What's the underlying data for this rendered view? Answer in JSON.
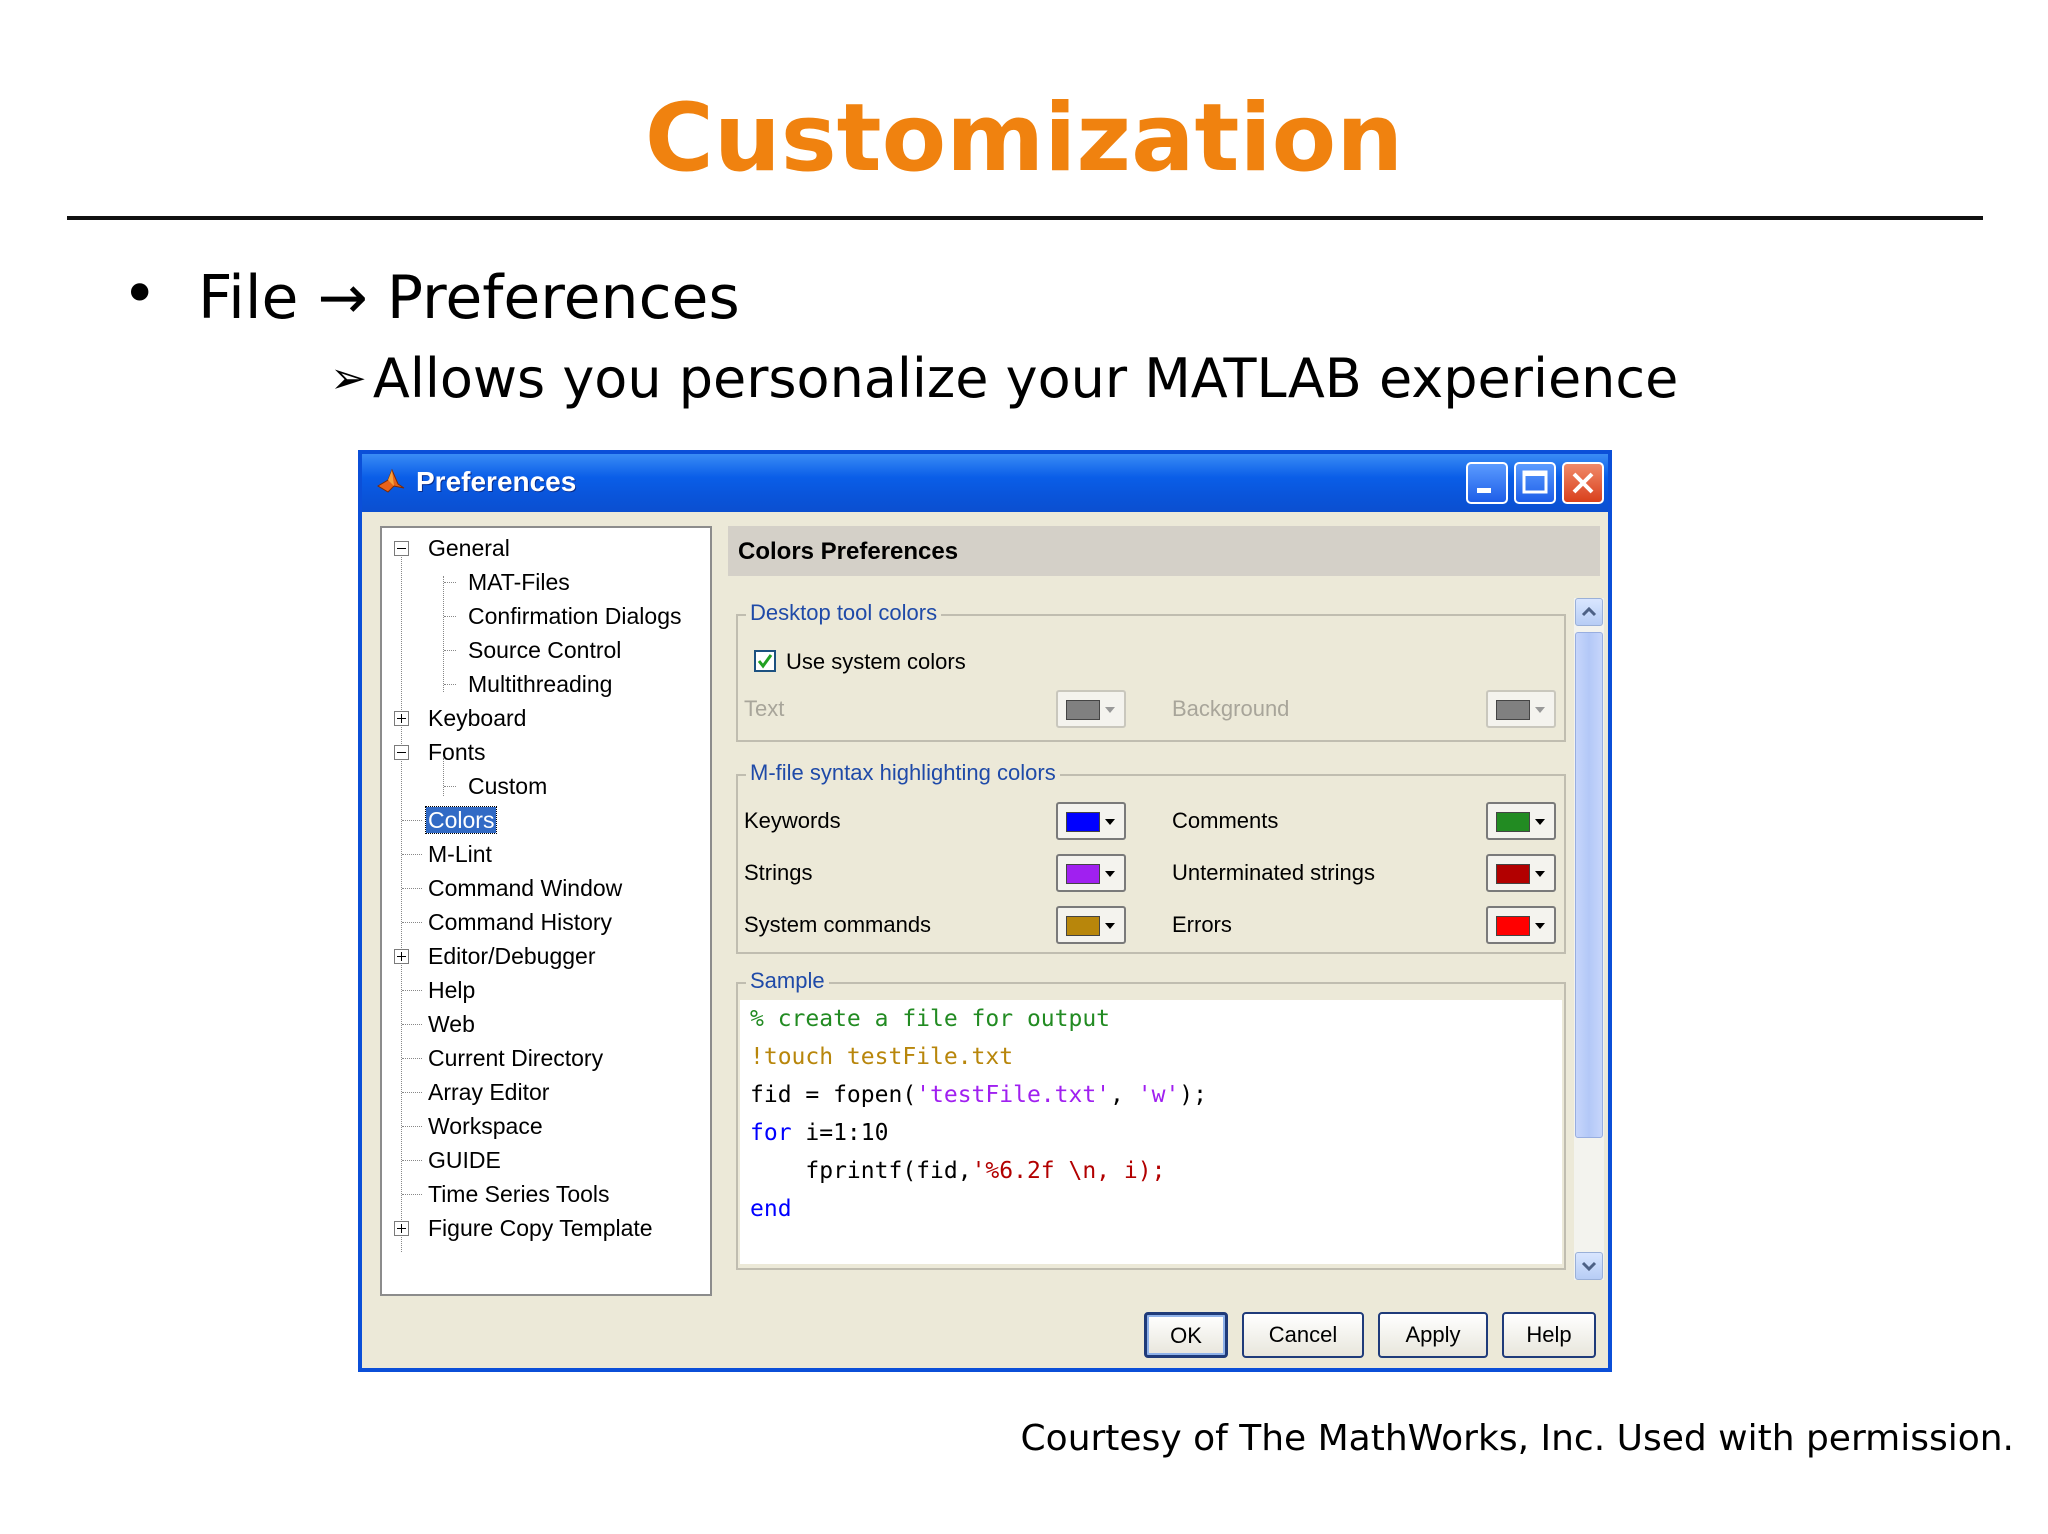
{
  "slide": {
    "title": "Customization",
    "bullet_main_before": "File",
    "bullet_main_arrow": "→",
    "bullet_main_after": "Preferences",
    "bullet_sub": "Allows you personalize your MATLAB experience",
    "courtesy": "Courtesy of The MathWorks, Inc. Used with permission."
  },
  "dialog": {
    "title": "Preferences",
    "tree": [
      {
        "label": "General",
        "expander": "minus"
      },
      {
        "label": "MAT-Files"
      },
      {
        "label": "Confirmation Dialogs"
      },
      {
        "label": "Source Control"
      },
      {
        "label": "Multithreading"
      },
      {
        "label": "Keyboard",
        "expander": "plus"
      },
      {
        "label": "Fonts",
        "expander": "minus"
      },
      {
        "label": "Custom"
      },
      {
        "label": "Colors",
        "selected": true
      },
      {
        "label": "M-Lint"
      },
      {
        "label": "Command Window"
      },
      {
        "label": "Command History"
      },
      {
        "label": "Editor/Debugger",
        "expander": "plus"
      },
      {
        "label": "Help"
      },
      {
        "label": "Web"
      },
      {
        "label": "Current Directory"
      },
      {
        "label": "Array Editor"
      },
      {
        "label": "Workspace"
      },
      {
        "label": "GUIDE"
      },
      {
        "label": "Time Series Tools"
      },
      {
        "label": "Figure Copy Template",
        "expander": "plus"
      }
    ],
    "panel_header": "Colors Preferences",
    "desktop_group": {
      "legend": "Desktop tool colors",
      "use_system_colors_label": "Use system colors",
      "use_system_colors_checked": true,
      "text_label": "Text",
      "background_label": "Background",
      "text_color": "#808080",
      "background_color": "#808080"
    },
    "syntax_group": {
      "legend": "M-file syntax highlighting colors",
      "keywords_label": "Keywords",
      "keywords_color": "#0000ff",
      "comments_label": "Comments",
      "comments_color": "#228b22",
      "strings_label": "Strings",
      "strings_color": "#a020f0",
      "unterminated_label": "Unterminated strings",
      "unterminated_color": "#b20000",
      "system_label": "System commands",
      "system_color": "#b8860b",
      "errors_label": "Errors",
      "errors_color": "#ff0000"
    },
    "sample_group": {
      "legend": "Sample",
      "line1": "% create a file for output",
      "line2": "!touch testFile.txt",
      "line3_a": "fid = fopen(",
      "line3_b": "'testFile.txt'",
      "line3_c": ", ",
      "line3_d": "'w'",
      "line3_e": ");",
      "line4_kw": "for",
      "line4_rest": " i=1:10",
      "line5_a": "    fprintf(fid,",
      "line5_b": "'%6.2f \\n, i);",
      "line6": "end"
    },
    "buttons": {
      "ok": "OK",
      "cancel": "Cancel",
      "apply": "Apply",
      "help": "Help"
    }
  }
}
